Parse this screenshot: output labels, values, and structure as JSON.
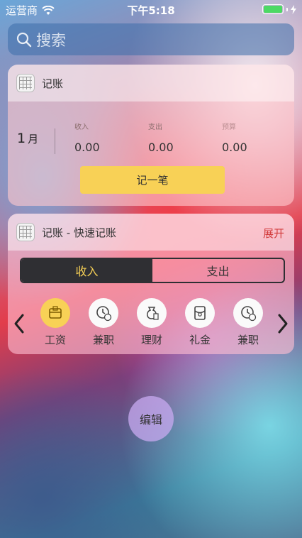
{
  "status_bar": {
    "carrier": "运营商",
    "time": "下午5:18",
    "wifi_icon": "wifi-icon",
    "battery_icon": "battery-icon",
    "charging_icon": "charging-bolt-icon",
    "battery_level": 1.0,
    "battery_color": "#4cd964"
  },
  "search": {
    "placeholder": "搜索",
    "icon": "search-icon"
  },
  "widget_bookkeeping": {
    "title": "记账",
    "month_number": "1",
    "month_unit": "月",
    "stats": [
      {
        "label": "收入",
        "value": "0.00"
      },
      {
        "label": "支出",
        "value": "0.00"
      },
      {
        "label": "预算",
        "value": "0.00"
      }
    ],
    "record_button": "记一笔",
    "accent_color": "#f8d156"
  },
  "widget_quick": {
    "title": "记账 - 快速记账",
    "expand": "展开",
    "tabs": {
      "active": "收入",
      "inactive": "支出"
    },
    "categories": [
      {
        "label": "工资",
        "icon": "wallet-icon",
        "selected": true
      },
      {
        "label": "兼职",
        "icon": "clock-yuan-icon",
        "selected": false
      },
      {
        "label": "理财",
        "icon": "money-bag-icon",
        "selected": false
      },
      {
        "label": "礼金",
        "icon": "red-envelope-icon",
        "selected": false
      },
      {
        "label": "兼职",
        "icon": "clock-yuan-icon",
        "selected": false
      }
    ],
    "expand_color": "#d23a3a"
  },
  "edit_button": "编辑"
}
